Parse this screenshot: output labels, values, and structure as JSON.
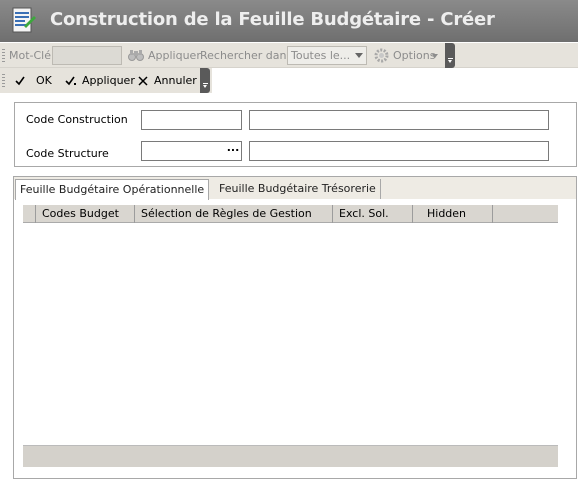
{
  "window": {
    "title": "Construction de la Feuille Budgétaire - Créer",
    "icon": "budget-sheet-icon"
  },
  "search_toolbar": {
    "keyword_label": "Mot-Clé",
    "keyword_value": "",
    "apply_label": "Appliquer",
    "search_in_label": "Rechercher dans",
    "search_in_value": "Toutes le...",
    "options_label": "Options"
  },
  "action_toolbar": {
    "ok_label": "OK",
    "apply_label": "Appliquer",
    "cancel_label": "Annuler"
  },
  "form": {
    "code_construction_label": "Code Construction",
    "code_construction_value": "",
    "code_construction_desc": "",
    "code_structure_label": "Code Structure",
    "code_structure_value": "",
    "code_structure_desc": "",
    "lookup_label": "..."
  },
  "tabs": [
    {
      "label": "Feuille Budgétaire Opérationnelle",
      "active": true
    },
    {
      "label": "Feuille Budgétaire Trésorerie",
      "active": false
    }
  ],
  "grid": {
    "columns": [
      "Codes Budget",
      "Sélection de Règles de Gestion",
      "Excl. Sol.",
      "Hidden"
    ],
    "rows": []
  }
}
